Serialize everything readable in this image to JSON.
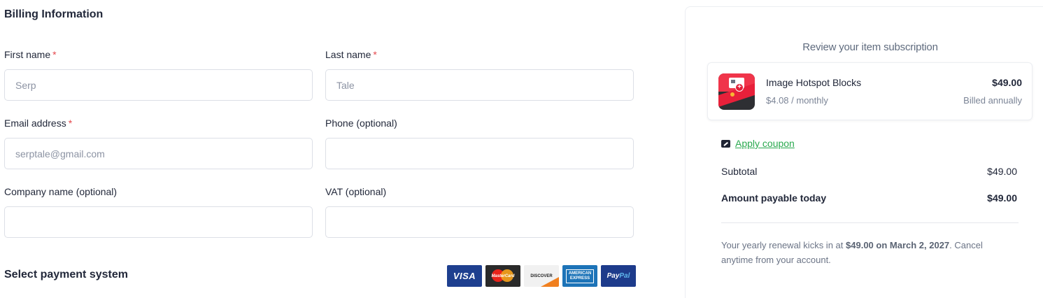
{
  "billing": {
    "title": "Billing Information",
    "first_name": {
      "label": "First name",
      "required": "*",
      "placeholder": "Serp"
    },
    "last_name": {
      "label": "Last name",
      "required": "*",
      "placeholder": "Tale"
    },
    "email": {
      "label": "Email address",
      "required": "*",
      "placeholder": "serptale@gmail.com"
    },
    "phone": {
      "label": "Phone (optional)",
      "placeholder": ""
    },
    "company": {
      "label": "Company name (optional)",
      "placeholder": ""
    },
    "vat": {
      "label": "VAT (optional)",
      "placeholder": ""
    }
  },
  "payment": {
    "title": "Select payment system",
    "cards": {
      "visa": "VISA",
      "mastercard": "MasterCard",
      "discover": "DISCOVER",
      "amex_line1": "AMERICAN",
      "amex_line2": "EXPRESS",
      "paypal_a": "Pay",
      "paypal_b": "Pal"
    }
  },
  "summary": {
    "title": "Review your item subscription",
    "item": {
      "name": "Image Hotspot Blocks",
      "monthly": "$4.08 / monthly",
      "price": "$49.00",
      "billing": "Billed annually"
    },
    "coupon_label": "Apply coupon",
    "subtotal_label": "Subtotal",
    "subtotal_value": "$49.00",
    "payable_label": "Amount payable today",
    "payable_value": "$49.00",
    "renewal_prefix": "Your yearly renewal kicks in at",
    "renewal_amount": "$49.00 on March 2, 2027",
    "renewal_suffix": ". Cancel anytime from your account."
  },
  "colors": {
    "required": "#e5484d",
    "coupon_link": "#2aa94f",
    "text_dark": "#22283a",
    "text_muted": "#7b8496"
  },
  "icons": [
    "coupon-icon",
    "product-logo"
  ]
}
